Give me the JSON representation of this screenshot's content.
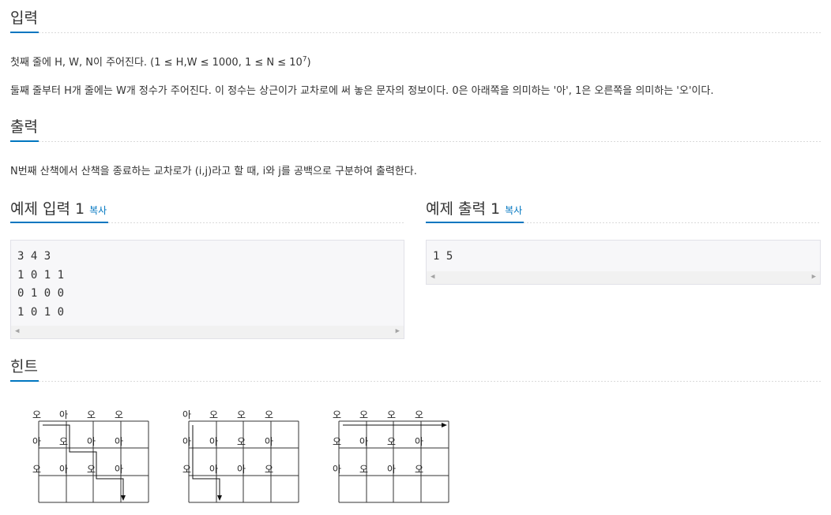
{
  "input_section": {
    "title": "입력",
    "line1_text": "첫째 줄에 H, W, N이 주어진다. (1 ≤ H,W ≤ 1000, 1 ≤ N ≤ 10",
    "line1_sup": "7",
    "line1_end": ")",
    "line2_text": "둘째 줄부터 H개 줄에는 W개 정수가 주어진다. 이 정수는 상근이가 교차로에 써 놓은 문자의 정보이다. 0은 아래쪽을 의미하는 '아', 1은 오른쪽을 의미하는 '오'이다."
  },
  "output_section": {
    "title": "출력",
    "text": "N번째 산책에서 산책을 종료하는 교차로가 (i,j)라고 할 때, i와 j를 공백으로 구분하여 출력한다."
  },
  "sample_input": {
    "title": "예제 입력 1",
    "copy_label": "복사",
    "content": "3 4 3\n1 0 1 1\n0 1 0 0\n1 0 1 0"
  },
  "sample_output": {
    "title": "예제 출력 1",
    "copy_label": "복사",
    "content": "1 5"
  },
  "hint_section": {
    "title": "힌트",
    "diagrams": [
      {
        "grid": [
          [
            "오",
            "아",
            "오",
            "오"
          ],
          [
            "아",
            "오",
            "아",
            "아"
          ],
          [
            "오",
            "아",
            "오",
            "아"
          ]
        ]
      },
      {
        "grid": [
          [
            "아",
            "오",
            "오",
            "오"
          ],
          [
            "아",
            "아",
            "오",
            "아"
          ],
          [
            "오",
            "아",
            "아",
            "오"
          ]
        ]
      },
      {
        "grid": [
          [
            "오",
            "오",
            "오",
            "오"
          ],
          [
            "오",
            "아",
            "오",
            "아"
          ],
          [
            "아",
            "오",
            "아",
            "오"
          ]
        ]
      }
    ]
  },
  "colors": {
    "accent": "#0076c0",
    "text": "#333333",
    "box_bg": "#f7f7f9",
    "box_border": "#e1e1e8"
  },
  "icons": {
    "scroll_left": "scroll-left-arrow-icon",
    "scroll_right": "scroll-right-arrow-icon"
  }
}
